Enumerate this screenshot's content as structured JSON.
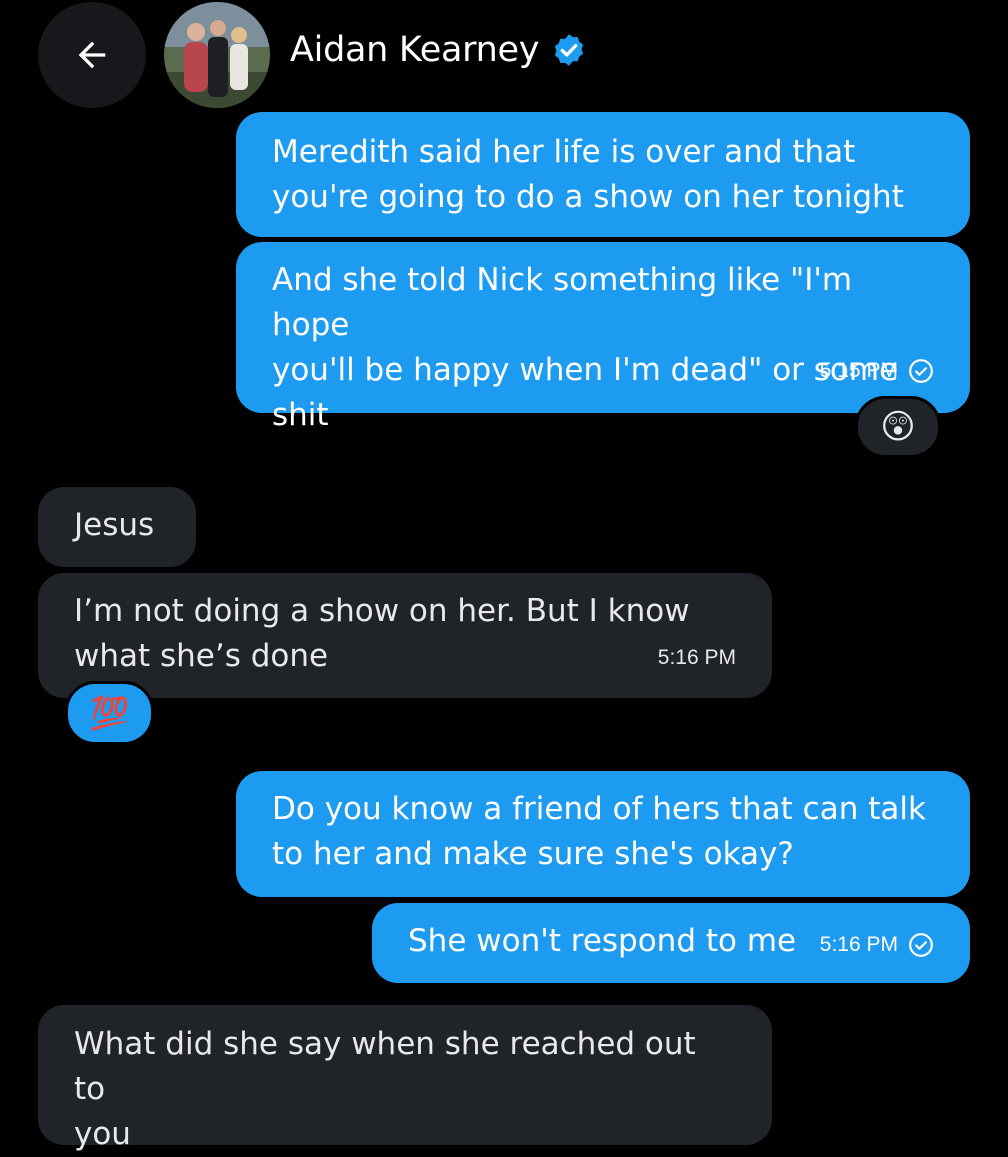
{
  "header": {
    "contact_name": "Aidan Kearney",
    "back_icon": "arrow-left-icon",
    "verified_icon": "verified-badge-icon",
    "verified_color": "#1d9bf0"
  },
  "colors": {
    "background": "#000000",
    "sent_bubble": "#1d9bf0",
    "received_bubble": "#202327"
  },
  "messages": [
    {
      "direction": "sent",
      "text": "Meredith said her life is over and that\nyou're going to do a show on her tonight"
    },
    {
      "direction": "sent",
      "text": "And she told Nick something like \"I'm hope\nyou'll be happy when I'm dead\" or some\nshit",
      "time": "5:15 PM",
      "status_icon": "read-check-icon",
      "reaction": "😲"
    },
    {
      "direction": "received",
      "text": "Jesus"
    },
    {
      "direction": "received",
      "text": "I’m not doing a show on her. But I know\nwhat she’s done",
      "time": "5:16 PM",
      "reaction": "💯"
    },
    {
      "direction": "sent",
      "text": "Do you know a friend of hers that can talk\nto her and make sure she's okay?"
    },
    {
      "direction": "sent",
      "text": "She won't respond to me",
      "time": "5:16 PM",
      "status_icon": "read-check-icon"
    },
    {
      "direction": "received",
      "text": "What did she say when she reached out to\nyou"
    }
  ]
}
